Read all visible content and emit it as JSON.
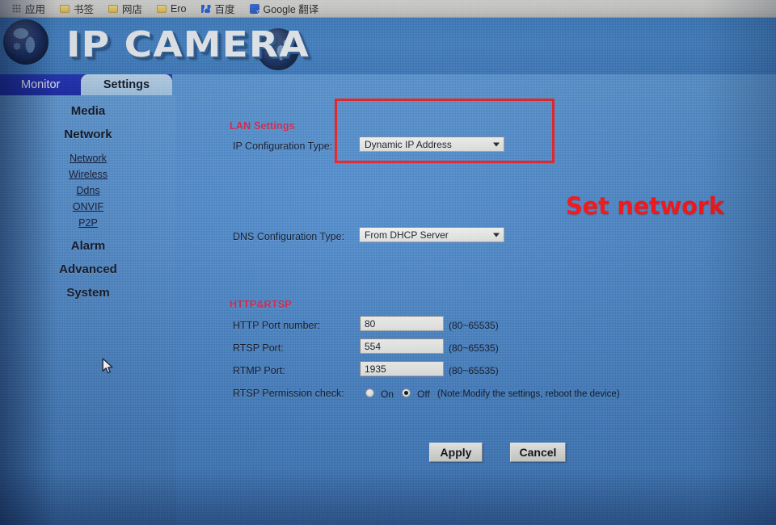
{
  "browser": {
    "bookmarks": [
      {
        "label": "应用",
        "icon": "apps-grid-icon"
      },
      {
        "label": "书签",
        "icon": "folder-icon"
      },
      {
        "label": "网店",
        "icon": "folder-icon"
      },
      {
        "label": "Ero",
        "icon": "folder-icon"
      },
      {
        "label": "百度",
        "icon": "baidu-paw-icon"
      },
      {
        "label": "Google 翻译",
        "icon": "google-translate-icon"
      }
    ]
  },
  "header": {
    "brand": "IP CAMERA",
    "left_globe": "globe-icon",
    "right_globe": "globe-icon"
  },
  "nav": {
    "tabs": [
      {
        "label": "Monitor",
        "active": false
      },
      {
        "label": "Settings",
        "active": true
      }
    ]
  },
  "sidebar": {
    "groups": [
      {
        "label": "Media",
        "type": "group"
      },
      {
        "label": "Network",
        "type": "group"
      },
      {
        "label": "Network",
        "type": "link"
      },
      {
        "label": "Wireless",
        "type": "link"
      },
      {
        "label": "Ddns",
        "type": "link"
      },
      {
        "label": "ONVIF",
        "type": "link"
      },
      {
        "label": "P2P",
        "type": "link"
      },
      {
        "label": "Alarm",
        "type": "group"
      },
      {
        "label": "Advanced",
        "type": "group"
      },
      {
        "label": "System",
        "type": "group"
      }
    ]
  },
  "lan": {
    "section_title": "LAN Settings",
    "ip_config_label": "IP Configuration Type:",
    "ip_config_value": "Dynamic IP Address",
    "dns_config_label": "DNS Configuration Type:",
    "dns_config_value": "From DHCP Server"
  },
  "http_rtsp": {
    "section_title": "HTTP&RTSP",
    "http_port_label": "HTTP Port number:",
    "http_port_value": "80",
    "http_port_hint": "(80~65535)",
    "rtsp_port_label": "RTSP Port:",
    "rtsp_port_value": "554",
    "rtsp_port_hint": "(80~65535)",
    "rtmp_port_label": "RTMP Port:",
    "rtmp_port_value": "1935",
    "rtmp_port_hint": "(80~65535)",
    "rtsp_perm_label": "RTSP Permission check:",
    "rtsp_perm_on": "On",
    "rtsp_perm_off": "Off",
    "rtsp_perm_selected": "Off",
    "rtsp_perm_note": "(Note:Modify the settings, reboot the device)"
  },
  "actions": {
    "apply_label": "Apply",
    "cancel_label": "Cancel"
  },
  "annotations": {
    "callout_text": "Set network",
    "callout_color": "#fd0f12",
    "highlight_box_color": "#ea1c22"
  },
  "colors": {
    "page_background": "#4a86c6",
    "banner": "#3d7ec0",
    "navbar": "#1a28ab",
    "active_tab": "#a9c7e4",
    "section_heading": "#d0214a"
  }
}
